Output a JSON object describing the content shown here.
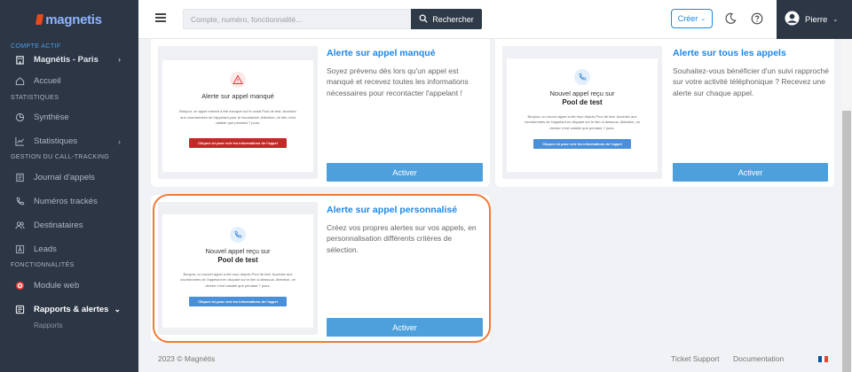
{
  "sidebar": {
    "logo": "magnetis",
    "sections": {
      "account": "COMPTE ACTIF",
      "stats": "STATISTIQUES",
      "tracking": "GESTION DU CALL-TRACKING",
      "features": "FONCTIONNALITÉS"
    },
    "account_name": "Magnétis - Paris",
    "items": {
      "home": "Accueil",
      "synthesis": "Synthèse",
      "statistics": "Statistiques",
      "call_log": "Journal d'appels",
      "tracked_numbers": "Numéros trackés",
      "recipients": "Destinataires",
      "leads": "Leads",
      "web_module": "Module web",
      "reports": "Rapports & alertes",
      "reports_sub": "Rapports"
    }
  },
  "header": {
    "search_placeholder": "Compte, numéro, fonctionnalité...",
    "search_button": "Rechercher",
    "create_button": "Créer",
    "user_name": "Pierre"
  },
  "cards": {
    "missed": {
      "preview_title": "Alerte sur appel manqué",
      "preview_body": "Bonjour, un appel entrant a été manqué sur le canal Pool de test. Accédez aux coordonnées de l'appelant pour le recontacter. Attention, ce lien n'est valable que pendant 7 jours.",
      "preview_button": "Cliquez ici pour voir les informations de l'appel",
      "title": "Alerte sur appel manqué",
      "description": "Soyez prévenu dès lors qu'un appel est manqué et recevez toutes les informations nécessaires pour recontacter l'appelant !",
      "button": "Activer"
    },
    "all_calls": {
      "preview_title": "Nouvel appel reçu sur",
      "preview_pool": "Pool de test",
      "preview_body": "Bonjour, un nouvel appel a été reçu depuis Pool de test. Accédez aux coordonnées de l'appelant en cliquant sur le lien ci-dessous. Attention, ce dernier n'est valable que pendant 7 jours.",
      "preview_button": "Cliquez ici pour voir les informations de l'appel",
      "title": "Alerte sur tous les appels",
      "description": "Souhaitez-vous bénéficier d'un suivi rapproché sur votre activité téléphonique ? Recevez une alerte sur chaque appel.",
      "button": "Activer"
    },
    "custom": {
      "preview_title": "Nouvel appel reçu sur",
      "preview_pool": "Pool de test",
      "preview_body": "Bonjour, un nouvel appel a été reçu depuis Pool de test. Accédez aux coordonnées de l'appelant en cliquant sur le lien ci-dessous. Attention, ce dernier n'est valable que pendant 7 jours.",
      "preview_button": "Cliquez ici pour voir les informations de l'appel",
      "title": "Alerte sur appel personnalisé",
      "description": "Créez vos propres alertes sur vos appels, en personnalisation différents critères de sélection.",
      "button": "Activer"
    }
  },
  "footer": {
    "copyright": "2023 © Magnétis",
    "support": "Ticket Support",
    "documentation": "Documentation"
  },
  "colors": {
    "sidebar": "#2c3645",
    "accent": "#1e88e5",
    "activate": "#4ea0dc",
    "highlight": "#f07a38",
    "missed_button": "#c62828"
  },
  "icons": [
    "hamburger-icon",
    "search-icon",
    "moon-icon",
    "help-icon",
    "user-icon",
    "home-icon",
    "pie-chart-icon",
    "line-chart-icon",
    "list-icon",
    "phone-icon",
    "users-icon",
    "lead-icon",
    "target-icon",
    "bell-icon",
    "warning-icon",
    "flag-fr-icon"
  ]
}
